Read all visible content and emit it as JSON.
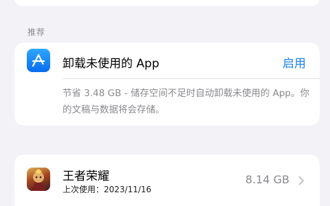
{
  "section_header": "推荐",
  "recommendation": {
    "icon": "app-store-icon",
    "title": "卸载未使用的 App",
    "action_label": "启用",
    "description": "节省 3.48 GB - 储存空间不足时自动卸载未使用的 App。你的文稿与数据将会存储。"
  },
  "apps": [
    {
      "icon": "game-icon",
      "name": "王者荣耀",
      "last_used": "上次使用：2023/11/16",
      "size": "8.14 GB"
    }
  ],
  "colors": {
    "background": "#f2f2f7",
    "accent": "#1a7ff2",
    "secondary_text": "#8a8a8e"
  }
}
